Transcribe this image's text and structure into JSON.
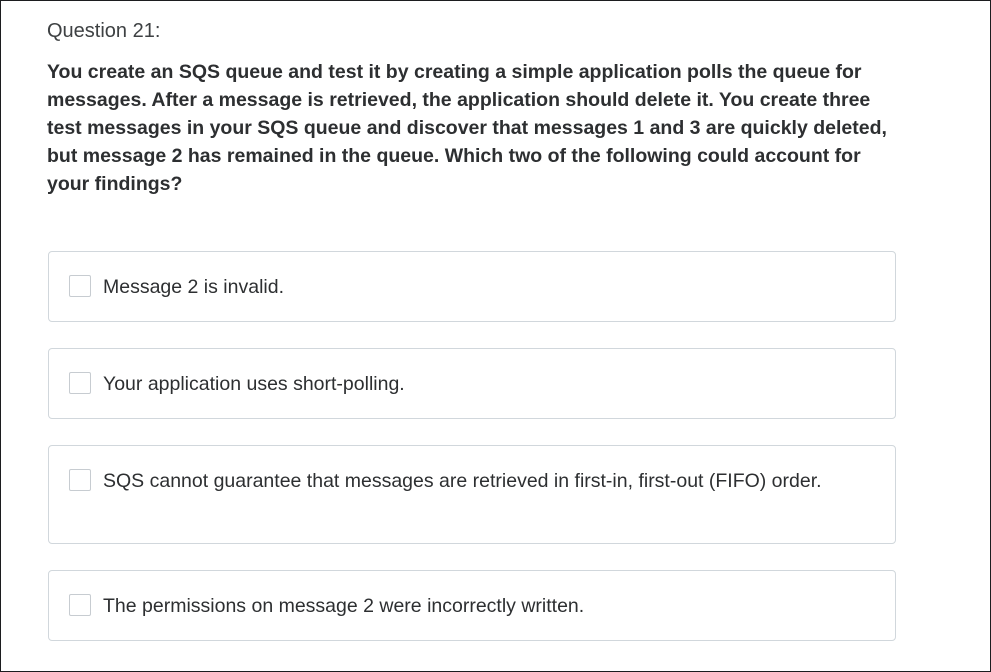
{
  "question": {
    "label": "Question 21:",
    "text": "You create an SQS queue and test it by creating a simple application polls the queue for messages. After a message is retrieved, the application should delete it. You create three test messages in your SQS queue and discover that messages 1 and 3 are quickly deleted, but message 2 has remained in the queue. Which two of the following could account for your findings?"
  },
  "options": [
    {
      "text": "Message 2 is invalid.",
      "checked": false
    },
    {
      "text": "Your application uses short-polling.",
      "checked": false
    },
    {
      "text": "SQS cannot guarantee that messages are retrieved in first-in, first-out (FIFO) order.",
      "checked": false
    },
    {
      "text": "The permissions on message 2 were incorrectly written.",
      "checked": false
    }
  ],
  "colors": {
    "border": "#d1d7dc",
    "text": "#2d2f31",
    "frame": "#1c1d1f"
  }
}
